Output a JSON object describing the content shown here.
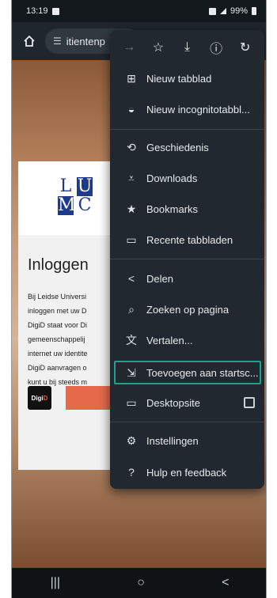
{
  "status": {
    "time": "13:19",
    "battery": "99%"
  },
  "toolbar": {
    "url_text": "itientenp"
  },
  "page": {
    "logo": {
      "l1": "L",
      "l2": "U",
      "l3": "M",
      "l4": "C"
    },
    "login_title": "Inloggen",
    "login_lines": [
      "Bij Leidse Universi",
      "inloggen met uw D",
      "DigiD staat voor Di",
      "gemeenschappelij",
      "internet uw identite",
      "DigiD aanvragen o",
      "kunt u bij steeds m"
    ],
    "digid_a": "Digi",
    "digid_b": "D"
  },
  "menu": {
    "top_icons": [
      "forward-arrow",
      "star",
      "download",
      "info",
      "refresh"
    ],
    "items": [
      {
        "label": "Nieuw tabblad",
        "icon": "new-tab"
      },
      {
        "label": "Nieuw incognitotabbl...",
        "icon": "incognito"
      },
      {
        "label": "Geschiedenis",
        "icon": "history"
      },
      {
        "label": "Downloads",
        "icon": "downloads"
      },
      {
        "label": "Bookmarks",
        "icon": "bookmarks"
      },
      {
        "label": "Recente tabbladen",
        "icon": "recent-tabs"
      },
      {
        "label": "Delen",
        "icon": "share"
      },
      {
        "label": "Zoeken op pagina",
        "icon": "find-in-page"
      },
      {
        "label": "Vertalen...",
        "icon": "translate"
      },
      {
        "label": "Toevoegen aan startsc...",
        "icon": "add-to-home"
      },
      {
        "label": "Desktopsite",
        "icon": "desktop"
      },
      {
        "label": "Instellingen",
        "icon": "settings"
      },
      {
        "label": "Hulp en feedback",
        "icon": "help"
      }
    ]
  },
  "colors": {
    "highlight": "#1aa48a",
    "menu_bg": "#21282f"
  }
}
